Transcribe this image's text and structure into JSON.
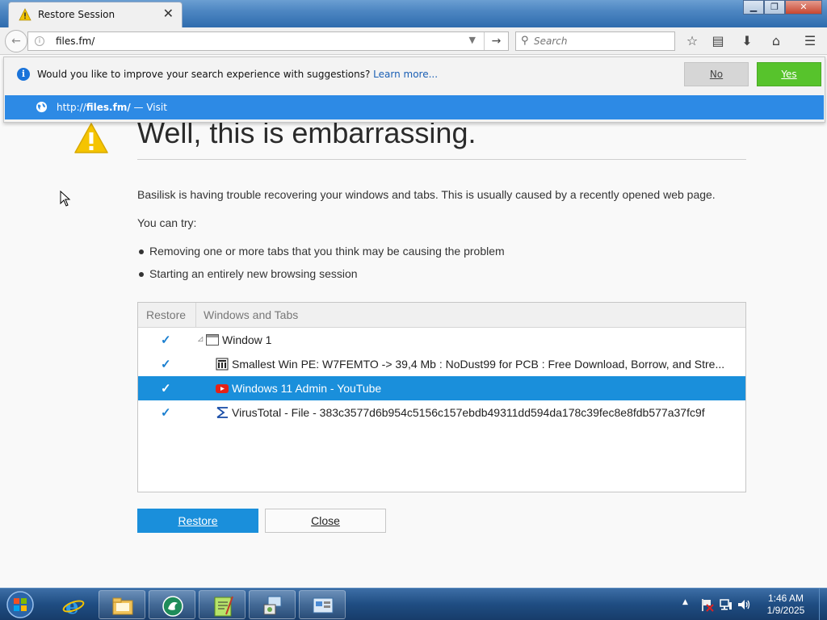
{
  "browser": {
    "tab_title": "Restore Session",
    "url": "files.fm/",
    "search_placeholder": "Search"
  },
  "suggestion": {
    "question": "Would you like to improve your search experience with suggestions?",
    "learn_more": "Learn more...",
    "no_label": "No",
    "yes_label": "Yes",
    "visit_prefix": "http://",
    "visit_bold": "files.fm/",
    "visit_suffix": " — Visit"
  },
  "page": {
    "heading": "Well, this is embarrassing.",
    "description": "Basilisk is having trouble recovering your windows and tabs. This is usually caused by a recently opened web page.",
    "you_can_try": "You can try:",
    "bullets": [
      "Removing one or more tabs that you think may be causing the problem",
      "Starting an entirely new browsing session"
    ],
    "table": {
      "col_restore": "Restore",
      "col_windows": "Windows and Tabs",
      "rows": [
        {
          "label": "Window 1",
          "checked": true,
          "selected": false
        },
        {
          "label": "Smallest Win PE: W7FEMTO -> 39,4 Mb : NoDust99 for PCB : Free Download, Borrow, and Stre...",
          "checked": true,
          "selected": false
        },
        {
          "label": "Windows 11 Admin - YouTube",
          "checked": true,
          "selected": true
        },
        {
          "label": "VirusTotal - File - 383c3577d6b954c5156c157ebdb49311dd594da178c39fec8e8fdb577a37fc9f",
          "checked": true,
          "selected": false
        }
      ]
    },
    "restore_label": "Restore",
    "close_label": "Close"
  },
  "taskbar": {
    "time": "1:46 AM",
    "date": "1/9/2025"
  },
  "colors": {
    "accent": "#1a8fdb",
    "yes_green": "#57c32c",
    "suggest_row": "#2d8ae5"
  }
}
